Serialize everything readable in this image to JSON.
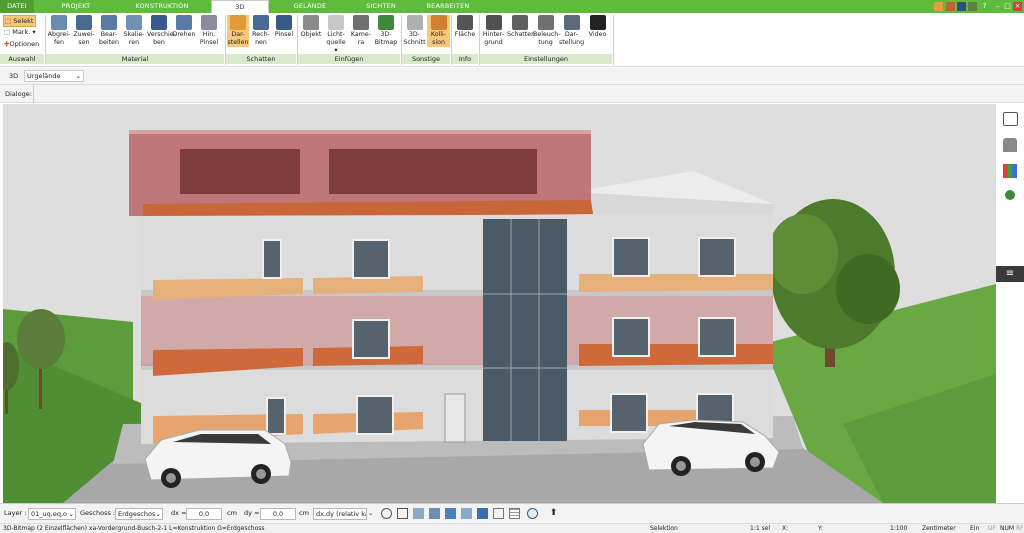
{
  "menu": {
    "tabs": [
      "DATEI",
      "PROJEKT",
      "KONSTRUKTION",
      "3D",
      "GELÄNDE",
      "SICHTEN",
      "BEARBEITEN"
    ],
    "active": "3D"
  },
  "ribbon": {
    "auswahl": {
      "select": "Selekt",
      "mark": "Mark.",
      "options": "Optionen",
      "group": "Auswahl"
    },
    "material": {
      "buttons": [
        [
          "Abgrei-",
          "fen"
        ],
        [
          "Zuwei-",
          "sen"
        ],
        [
          "Bear-",
          "beiten"
        ],
        [
          "Skalie-",
          "ren"
        ],
        [
          "Verschie-",
          "ben"
        ],
        [
          "Drehen",
          ""
        ],
        [
          "Hin.",
          "Pinsel"
        ]
      ],
      "group": "Material"
    },
    "schatten": {
      "buttons": [
        [
          "Dar-",
          "stellen"
        ],
        [
          "Rech-",
          "nen"
        ],
        [
          "Pinsel",
          ""
        ]
      ],
      "group": "Schatten"
    },
    "einfuegen": {
      "buttons": [
        [
          "Objekt",
          ""
        ],
        [
          "Licht-",
          "quelle ▾"
        ],
        [
          "Kame-",
          "ra"
        ],
        [
          "3D-",
          "Bitmap"
        ]
      ],
      "group": "Einfügen"
    },
    "sonstige": {
      "buttons": [
        [
          "3D-",
          "Schnitt"
        ],
        [
          "Kolli-",
          "sion"
        ]
      ],
      "group": "Sonstige"
    },
    "info": {
      "buttons": [
        [
          "Fläche",
          ""
        ]
      ],
      "group": "Info"
    },
    "einstellungen": {
      "buttons": [
        [
          "Hinter-",
          "grund"
        ],
        [
          "Schatten",
          ""
        ],
        [
          "Beleuch-",
          "tung"
        ],
        [
          "Dar-",
          "stellung"
        ],
        [
          "Video",
          ""
        ]
      ],
      "group": "Einstellungen"
    }
  },
  "viewbar": {
    "mode": "3D",
    "terrain": "Urgelände"
  },
  "dialogbar": {
    "label": "Dialoge:"
  },
  "bottom": {
    "layer_label": "Layer :",
    "layer_value": "01_uq,eq,o",
    "geschoss_label": "Geschoss :",
    "geschoss_value": "Erdgeschos",
    "dx_label": "dx =",
    "dx_value": "0,0",
    "dx_unit": "cm",
    "dy_label": "dy =",
    "dy_value": "0,0",
    "dy_unit": "cm",
    "mode_value": "dx,dy (relativ ka"
  },
  "status": {
    "info": "3D-Bitmap (2 Einzelflächen) xa-Vordergrund-Busch-2-1 L=Konstruktion G=Erdgeschoss",
    "selektion": "Selektion",
    "scale": "1:1 sel",
    "x": "X:",
    "y": "Y:",
    "ratio": "1:100",
    "unit": "Zentimeter",
    "ein": "Ein",
    "uf": "UF",
    "num": "NUM",
    "rf": "RF"
  },
  "colors": {
    "accent": "#5fbb3b",
    "groupbar": "#d7ebcb",
    "active_button": "#f9c77a"
  }
}
